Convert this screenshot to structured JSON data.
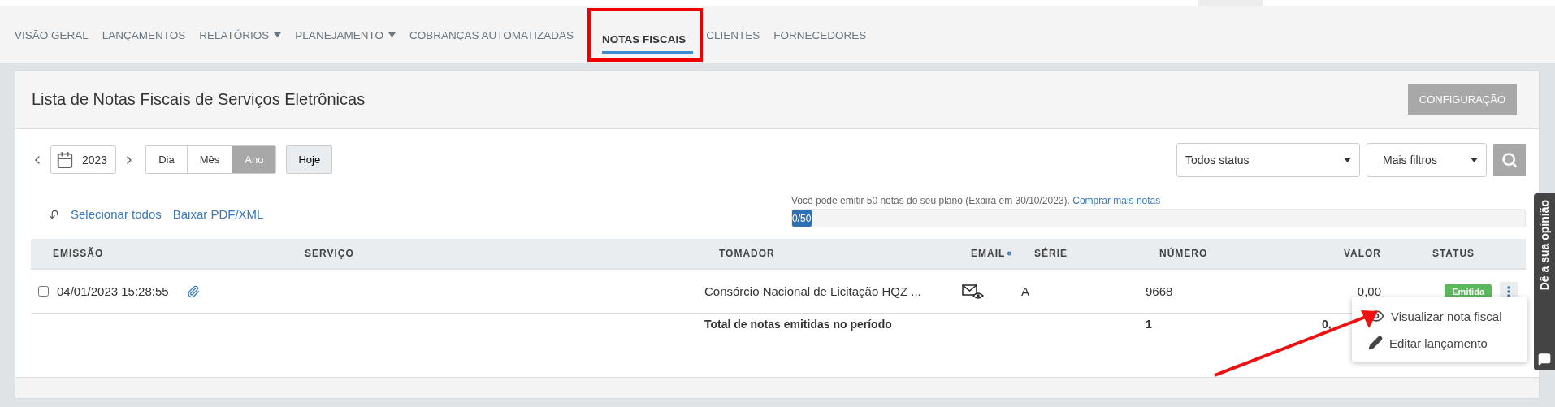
{
  "nav": {
    "items": [
      {
        "label": "VISÃO GERAL",
        "selected": false,
        "has_menu": false,
        "highlighted": false
      },
      {
        "label": "LANÇAMENTOS",
        "selected": false,
        "has_menu": false,
        "highlighted": false
      },
      {
        "label": "RELATÓRIOS",
        "selected": false,
        "has_menu": true,
        "highlighted": false
      },
      {
        "label": "PLANEJAMENTO",
        "selected": false,
        "has_menu": true,
        "highlighted": false
      },
      {
        "label": "COBRANÇAS AUTOMATIZADAS",
        "selected": false,
        "has_menu": false,
        "highlighted": false
      },
      {
        "label": "NOTAS FISCAIS",
        "selected": true,
        "has_menu": false,
        "highlighted": true
      },
      {
        "label": "CLIENTES",
        "selected": false,
        "has_menu": false,
        "highlighted": false
      },
      {
        "label": "FORNECEDORES",
        "selected": false,
        "has_menu": false,
        "highlighted": false
      }
    ]
  },
  "card": {
    "title": "Lista de Notas Fiscais de Serviços Eletrônicas",
    "config_button": "CONFIGURAÇÃO"
  },
  "period": {
    "year": "2023",
    "views": [
      {
        "label": "Dia",
        "selected": false
      },
      {
        "label": "Mês",
        "selected": false
      },
      {
        "label": "Ano",
        "selected": true
      }
    ],
    "today": "Hoje"
  },
  "filters": {
    "status": "Todos status",
    "more": "Mais filtros"
  },
  "actions": {
    "select_all": "Selecionar todos",
    "download": "Baixar PDF/XML"
  },
  "quota": {
    "text": "Você pode emitir 50 notas do seu plano (Expira em 30/10/2023).",
    "link": "Comprar mais notas",
    "progress_label": "0/50",
    "level": 0
  },
  "table": {
    "columns": [
      {
        "label": "EMISSÃO",
        "info": false
      },
      {
        "label": "SERVIÇO",
        "info": false
      },
      {
        "label": "TOMADOR",
        "info": false
      },
      {
        "label": "EMAIL",
        "info": true
      },
      {
        "label": "SÉRIE",
        "info": false
      },
      {
        "label": "NÚMERO",
        "info": false
      },
      {
        "label": "VALOR",
        "info": false
      },
      {
        "label": "STATUS",
        "info": false
      }
    ],
    "rows": [
      {
        "checked": false,
        "emissao": "04/01/2023 15:28:55",
        "attachment": true,
        "tomador": "Consórcio Nacional de Licitação HQZ ...",
        "email_viewed": true,
        "serie": "A",
        "numero": "9668",
        "valor": "0,00",
        "status": "Emitida"
      }
    ],
    "total": {
      "label": "Total de notas emitidas no período",
      "numero": "1",
      "valor": "0,"
    }
  },
  "row_menu": {
    "items": [
      {
        "kind": "view",
        "label": "Visualizar nota fiscal"
      },
      {
        "kind": "edit",
        "label": "Editar lançamento"
      }
    ]
  },
  "annotations": [
    {
      "kind": "arrow"
    }
  ],
  "feedback": {
    "label": "Dê a sua opinião"
  }
}
